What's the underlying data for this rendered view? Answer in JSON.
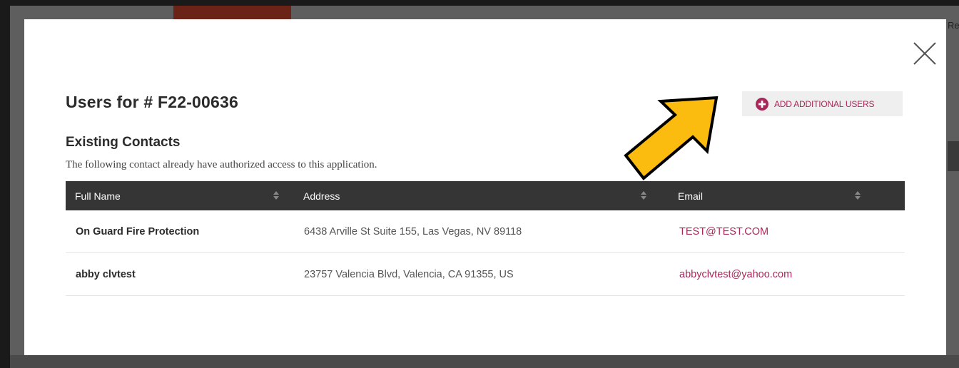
{
  "background": {
    "side_text": "Re"
  },
  "modal": {
    "title": "Users for # F22-00636",
    "add_button_label": "ADD ADDITIONAL USERS",
    "section_title": "Existing Contacts",
    "section_description": "The following contact already have authorized access to this application.",
    "table": {
      "headers": [
        "Full Name",
        "Address",
        "Email"
      ],
      "rows": [
        {
          "name": "On Guard Fire Protection",
          "address": "6438 Arville St Suite 155, Las Vegas, NV 89118",
          "email": "TEST@TEST.COM"
        },
        {
          "name": "abby clvtest",
          "address": "23757 Valencia Blvd, Valencia, CA 91355, US",
          "email": "abbyclvtest@yahoo.com"
        }
      ]
    }
  },
  "icons": {
    "close": "close-icon",
    "plus": "plus-circle-icon",
    "sort": "sort-icon",
    "annotation": "yellow-arrow"
  },
  "colors": {
    "accent": "#a8285a",
    "header_bg": "#353535",
    "button_bg": "#efefef",
    "arrow_fill": "#fbbc0f",
    "tab": "#6b2317"
  }
}
